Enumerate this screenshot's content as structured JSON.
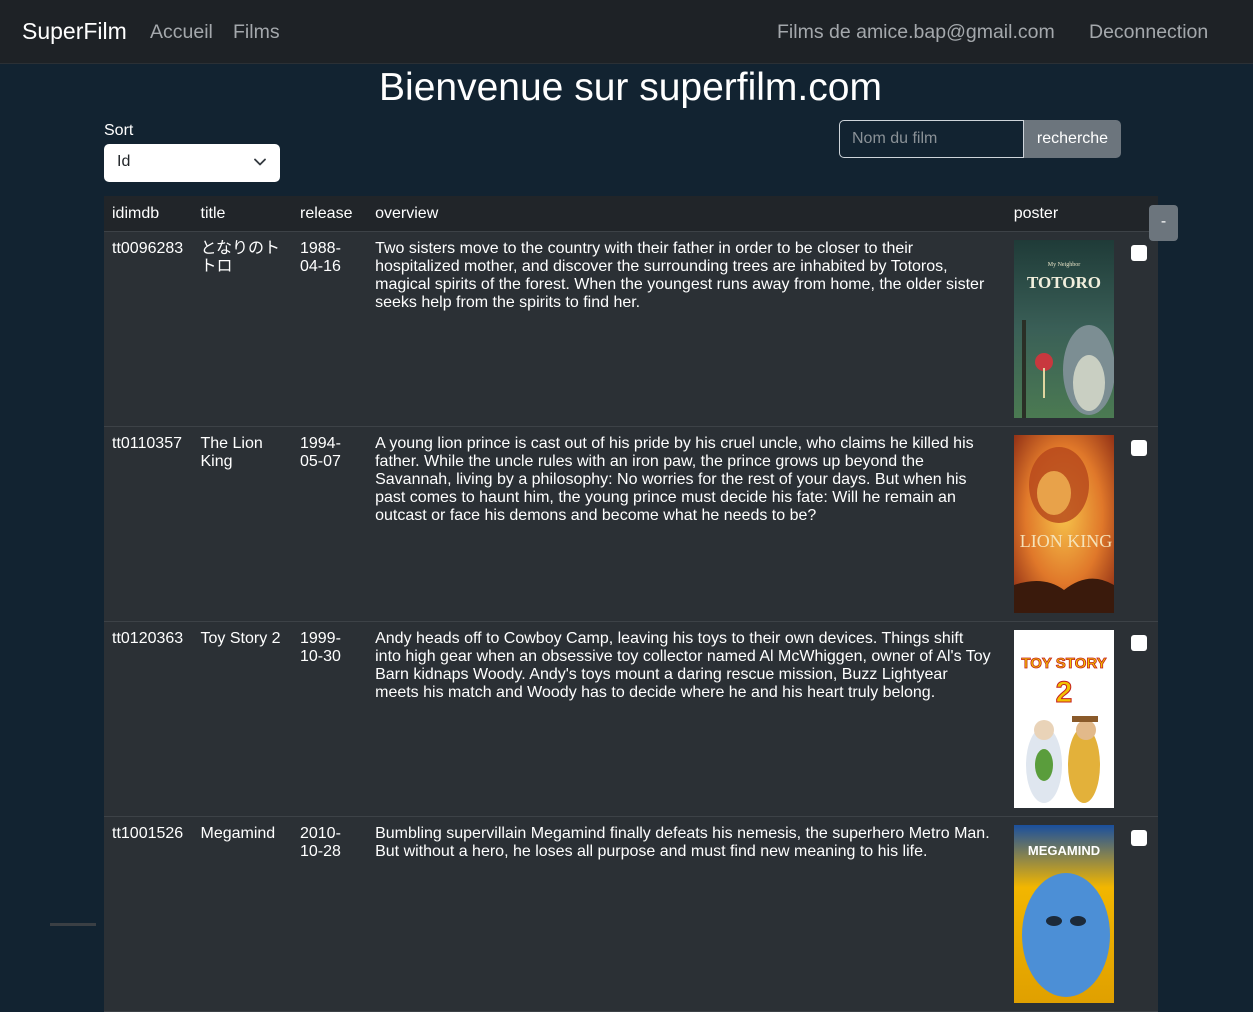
{
  "nav": {
    "brand": "SuperFilm",
    "accueil": "Accueil",
    "films": "Films",
    "user_films": "Films de amice.bap@gmail.com",
    "logout": "Deconnection"
  },
  "page_title": "Bienvenue sur superfilm.com",
  "sort": {
    "label": "Sort",
    "selected": "Id"
  },
  "search": {
    "placeholder": "Nom du film",
    "button": "recherche"
  },
  "table": {
    "headers": [
      "idimdb",
      "title",
      "release",
      "overview",
      "poster",
      ""
    ],
    "rows": [
      {
        "id": "tt0096283",
        "title": "となりのトトロ",
        "release": "1988-04-16",
        "overview": "Two sisters move to the country with their father in order to be closer to their hospitalized mother, and discover the surrounding trees are inhabited by Totoros, magical spirits of the forest. When the youngest runs away from home, the older sister seeks help from the spirits to find her.",
        "poster_text": "TOTORO",
        "poster_subtext": "My Neighbor"
      },
      {
        "id": "tt0110357",
        "title": "The Lion King",
        "release": "1994-05-07",
        "overview": "A young lion prince is cast out of his pride by his cruel uncle, who claims he killed his father. While the uncle rules with an iron paw, the prince grows up beyond the Savannah, living by a philosophy: No worries for the rest of your days. But when his past comes to haunt him, the young prince must decide his fate: Will he remain an outcast or face his demons and become what he needs to be?",
        "poster_text": "LION KING",
        "poster_subtext": ""
      },
      {
        "id": "tt0120363",
        "title": "Toy Story 2",
        "release": "1999-10-30",
        "overview": "Andy heads off to Cowboy Camp, leaving his toys to their own devices. Things shift into high gear when an obsessive toy collector named Al McWhiggen, owner of Al's Toy Barn kidnaps Woody. Andy's toys mount a daring rescue mission, Buzz Lightyear meets his match and Woody has to decide where he and his heart truly belong.",
        "poster_text": "TOY STORY",
        "poster_subtext": "2"
      },
      {
        "id": "tt1001526",
        "title": "Megamind",
        "release": "2010-10-28",
        "overview": "Bumbling supervillain Megamind finally defeats his nemesis, the superhero Metro Man. But without a hero, he loses all purpose and must find new meaning to his life.",
        "poster_text": "MEGAMIND",
        "poster_subtext": ""
      }
    ]
  },
  "minus_button": "-"
}
